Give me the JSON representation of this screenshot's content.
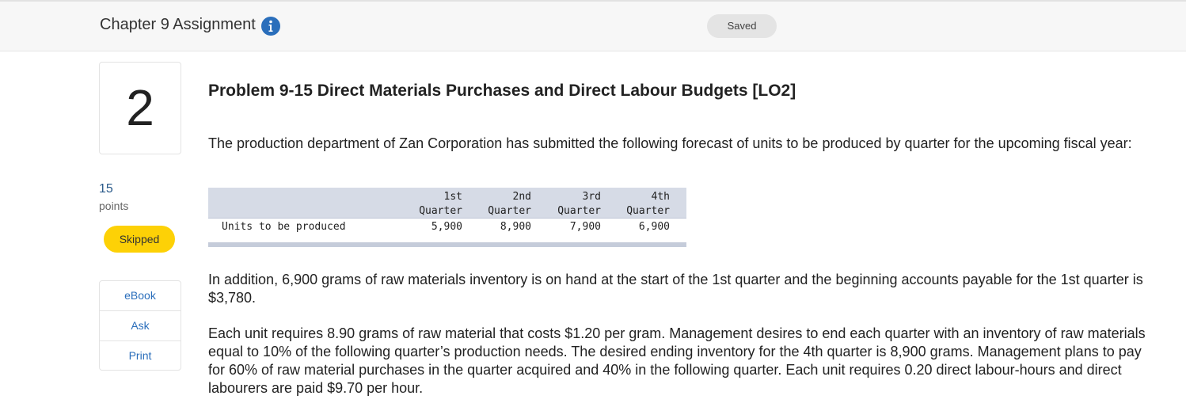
{
  "header": {
    "title": "Chapter 9 Assignment",
    "saved_label": "Saved"
  },
  "question": {
    "number": "2",
    "points_value": "15",
    "points_label": "points",
    "status": "Skipped"
  },
  "side_tools": [
    {
      "label": "eBook"
    },
    {
      "label": "Ask"
    },
    {
      "label": "Print"
    }
  ],
  "problem": {
    "title": "Problem 9-15 Direct Materials Purchases and Direct Labour Budgets [LO2]",
    "intro": "The production department of Zan Corporation has submitted the following forecast of units to be produced by quarter for the upcoming fiscal year:",
    "table": {
      "headers": [
        {
          "line1": "1st",
          "line2": "Quarter"
        },
        {
          "line1": "2nd",
          "line2": "Quarter"
        },
        {
          "line1": "3rd",
          "line2": "Quarter"
        },
        {
          "line1": "4th",
          "line2": "Quarter"
        }
      ],
      "row_label": "Units to be produced",
      "values": [
        "5,900",
        "8,900",
        "7,900",
        "6,900"
      ]
    },
    "para2": "In addition, 6,900 grams of raw materials inventory is on hand at the start of the 1st quarter and the beginning accounts payable for the 1st quarter is $3,780.",
    "para3": "Each unit requires 8.90 grams of raw material that costs $1.20 per gram. Management desires to end each quarter with an inventory of raw materials equal to 10% of the following quarter’s production needs. The desired ending inventory for the 4th quarter is 8,900 grams. Management plans to pay for 60% of raw material purchases in the quarter acquired and 40% in the following quarter. Each unit requires 0.20 direct labour-hours and direct labourers are paid $9.70 per hour."
  },
  "colors": {
    "info_icon": "#2a6ebb",
    "skipped_badge": "#fdd106",
    "link": "#2a6ebb"
  }
}
